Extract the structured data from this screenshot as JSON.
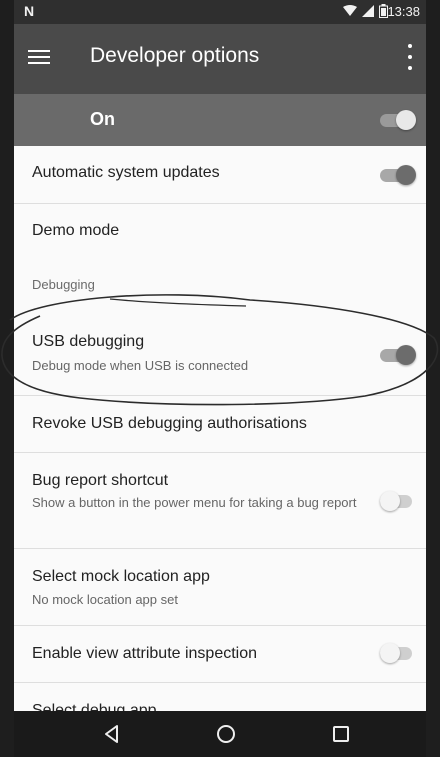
{
  "status_bar": {
    "left_icon": "N",
    "time": "13:38",
    "icons": [
      "wifi-icon",
      "signal-icon",
      "battery-icon"
    ]
  },
  "toolbar": {
    "title": "Developer options"
  },
  "master_switch": {
    "label": "On",
    "state": true
  },
  "settings": [
    {
      "title": "Automatic system updates",
      "summary": "",
      "switch": true
    },
    {
      "title": "Demo mode",
      "summary": "",
      "switch": null
    },
    {
      "category": "Debugging"
    },
    {
      "title": "USB debugging",
      "summary": "Debug mode when USB is connected",
      "switch": true
    },
    {
      "title": "Revoke USB debugging authorisations",
      "summary": "",
      "switch": null
    },
    {
      "title": "Bug report shortcut",
      "summary": "Show a button in the power menu for taking a bug report",
      "switch": false
    },
    {
      "title": "Select mock location app",
      "summary": "No mock location app set",
      "switch": null
    },
    {
      "title": "Enable view attribute inspection",
      "summary": "",
      "switch": false
    },
    {
      "title": "Select debug app",
      "summary": "",
      "switch": null
    }
  ],
  "nav_bar": {
    "buttons": [
      "back-icon",
      "home-icon",
      "recents-icon"
    ]
  },
  "colors": {
    "status_bar": "#2f2f2f",
    "toolbar": "#4a4a4a",
    "master_bar": "#6a6a6a",
    "nav_bar": "#1a1a1a"
  }
}
